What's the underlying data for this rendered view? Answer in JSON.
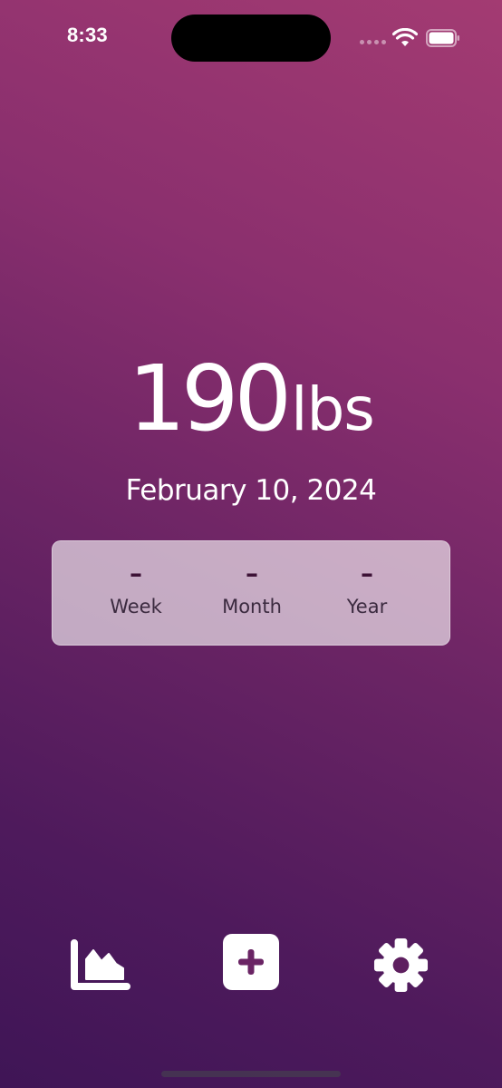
{
  "status_bar": {
    "time": "8:33",
    "icons": [
      "signal-dots-icon",
      "wifi-icon",
      "battery-icon"
    ]
  },
  "reading": {
    "value": "190",
    "unit": "lbs",
    "date": "February 10, 2024"
  },
  "stats": [
    {
      "value": "–",
      "label": "Week"
    },
    {
      "value": "–",
      "label": "Month"
    },
    {
      "value": "–",
      "label": "Year"
    }
  ],
  "toolbar": {
    "items": [
      "chart-icon",
      "add-entry-icon",
      "settings-gear-icon"
    ]
  },
  "colors": {
    "gradient_top_right": "#a33b72",
    "gradient_bottom_left": "#3f1556",
    "card_background": "rgba(255,255,255,0.62)",
    "stat_text": "#3d1236",
    "icon": "#ffffff"
  }
}
